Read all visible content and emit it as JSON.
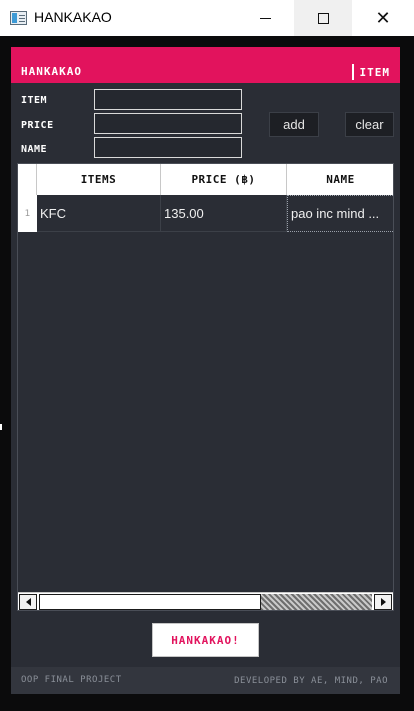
{
  "window": {
    "title": "HANKAKAO",
    "minimize_glyph": "",
    "maximize_glyph": "",
    "close_glyph": "✕"
  },
  "header": {
    "brand": "HANKAKAO",
    "section": "ITEM"
  },
  "form": {
    "item_label": "ITEM",
    "price_label": "PRICE",
    "name_label": "NAME",
    "item_value": "",
    "price_value": "",
    "name_value": "",
    "add_label": "add",
    "clear_label": "clear"
  },
  "table": {
    "columns": [
      "ITEMS",
      "PRICE (฿)",
      "NAME"
    ],
    "rows": [
      {
        "index": "1",
        "item": "KFC",
        "price": "135.00",
        "name": "pao inc mind ..."
      }
    ]
  },
  "actions": {
    "brand_button": "HANKAKAO!"
  },
  "footer": {
    "left": "OOP FINAL PROJECT",
    "right": "DEVELOPED BY AE, MIND, PAO"
  },
  "colors": {
    "accent": "#e2135d",
    "surface": "#2a2d35",
    "frame": "#0b0b0c"
  },
  "icons": {
    "app": "app-window-icon",
    "minimize": "minimize-icon",
    "maximize": "maximize-icon",
    "close": "close-icon",
    "scroll_left": "arrow-left-icon",
    "scroll_right": "arrow-right-icon"
  }
}
